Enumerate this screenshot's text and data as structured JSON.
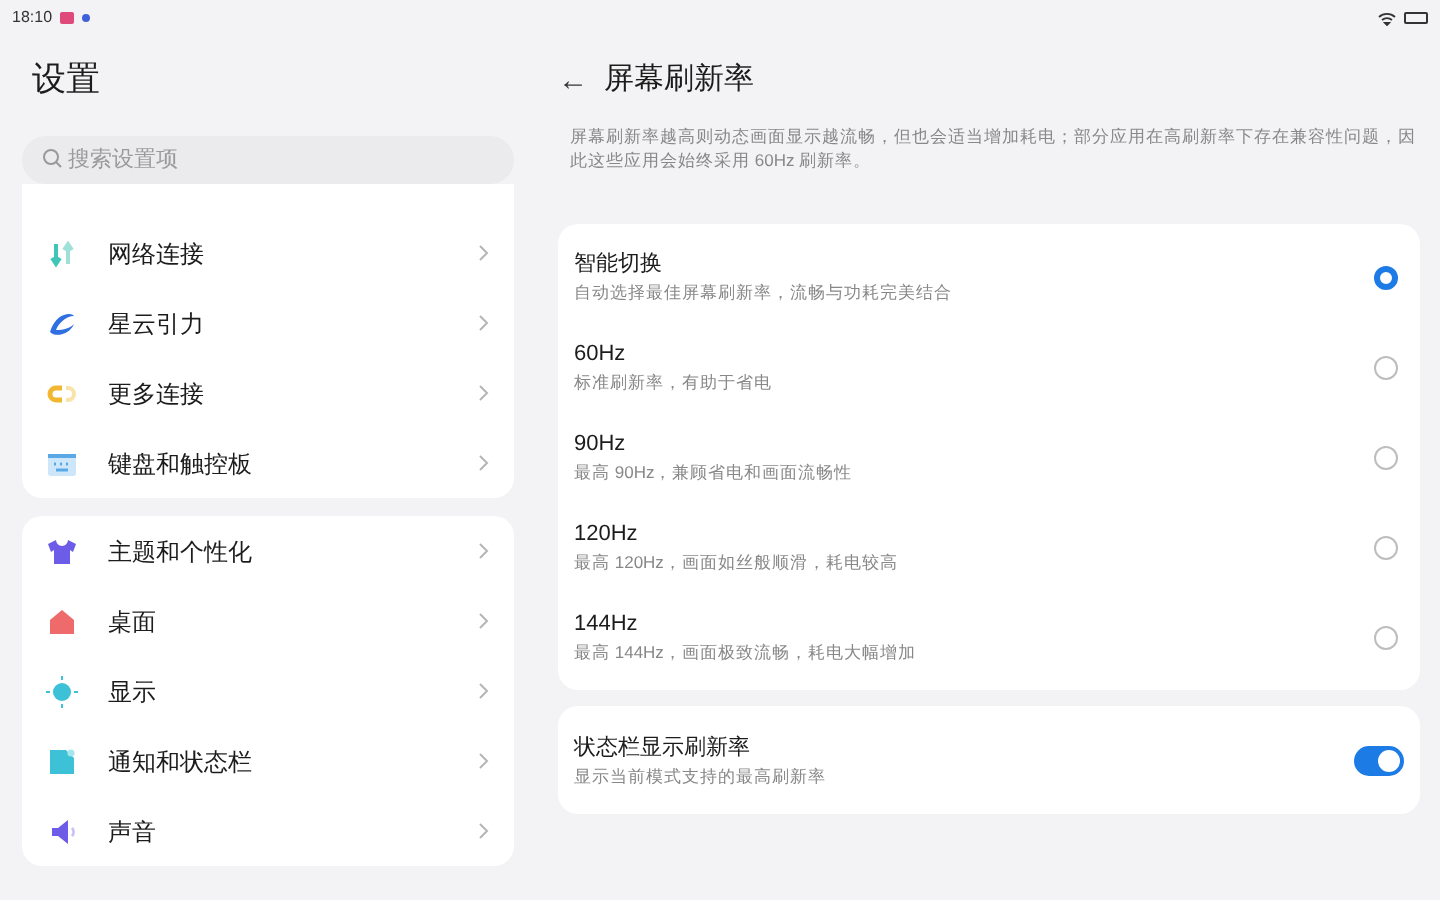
{
  "status_bar": {
    "time": "18:10"
  },
  "sidebar": {
    "title": "设置",
    "search": {
      "placeholder": "搜索设置项"
    },
    "groups": [
      {
        "items": [
          {
            "label": "网络连接"
          },
          {
            "label": "星云引力"
          },
          {
            "label": "更多连接"
          },
          {
            "label": "键盘和触控板"
          }
        ]
      },
      {
        "items": [
          {
            "label": "主题和个性化"
          },
          {
            "label": "桌面"
          },
          {
            "label": "显示"
          },
          {
            "label": "通知和状态栏"
          },
          {
            "label": "声音"
          }
        ]
      }
    ]
  },
  "detail": {
    "title": "屏幕刷新率",
    "back": "←",
    "description": "屏幕刷新率越高则动态画面显示越流畅，但也会适当增加耗电；部分应用在高刷新率下存在兼容性问题，因此这些应用会始终采用 60Hz 刷新率。",
    "options": [
      {
        "label": "智能切换",
        "sub": "自动选择最佳屏幕刷新率，流畅与功耗完美结合",
        "selected": true
      },
      {
        "label": "60Hz",
        "sub": "标准刷新率，有助于省电",
        "selected": false
      },
      {
        "label": "90Hz",
        "sub": "最高 90Hz，兼顾省电和画面流畅性",
        "selected": false
      },
      {
        "label": "120Hz",
        "sub": "最高 120Hz，画面如丝般顺滑，耗电较高",
        "selected": false
      },
      {
        "label": "144Hz",
        "sub": "最高 144Hz，画面极致流畅，耗电大幅增加",
        "selected": false
      }
    ],
    "toggle": {
      "label": "状态栏显示刷新率",
      "sub": "显示当前模式支持的最高刷新率",
      "on": true
    }
  }
}
